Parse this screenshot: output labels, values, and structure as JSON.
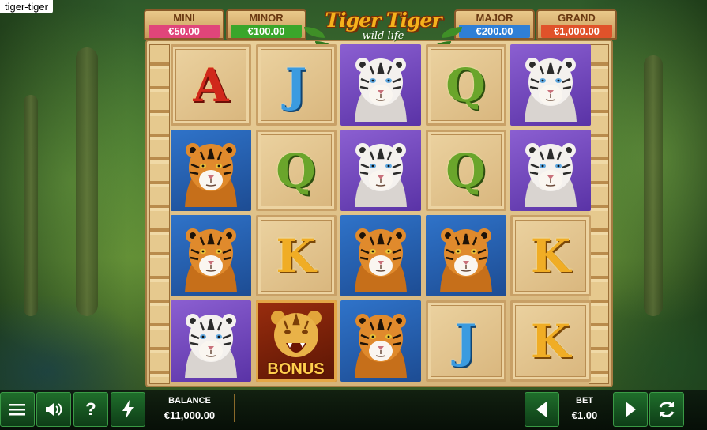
{
  "window": {
    "title": "tiger-tiger"
  },
  "logo": {
    "main": "Tiger Tiger",
    "sub": "wild life"
  },
  "jackpots": [
    {
      "name": "MINI",
      "value": "€50.00",
      "color": "#e0457a"
    },
    {
      "name": "MINOR",
      "value": "€100.00",
      "color": "#3aa62b"
    },
    {
      "name": "MAJOR",
      "value": "€200.00",
      "color": "#2f7fd6"
    },
    {
      "name": "GRAND",
      "value": "€1,000.00",
      "color": "#e0522a"
    }
  ],
  "reels": [
    [
      "A",
      "J",
      "white-tiger",
      "Q",
      "white-tiger"
    ],
    [
      "tiger",
      "Q",
      "white-tiger",
      "Q",
      "white-tiger"
    ],
    [
      "tiger",
      "K",
      "tiger",
      "tiger",
      "K"
    ],
    [
      "white-tiger",
      "bonus",
      "tiger",
      "J",
      "K"
    ]
  ],
  "bonus": {
    "label": "BONUS"
  },
  "controls": {
    "menu_icon": "menu-icon",
    "sound_icon": "speaker-icon",
    "help_label": "?",
    "turbo_icon": "lightning-icon",
    "balance_label": "BALANCE",
    "balance_value": "€11,000.00",
    "bet_label": "BET",
    "bet_value": "€1.00",
    "spin_icon": "refresh-icon"
  }
}
